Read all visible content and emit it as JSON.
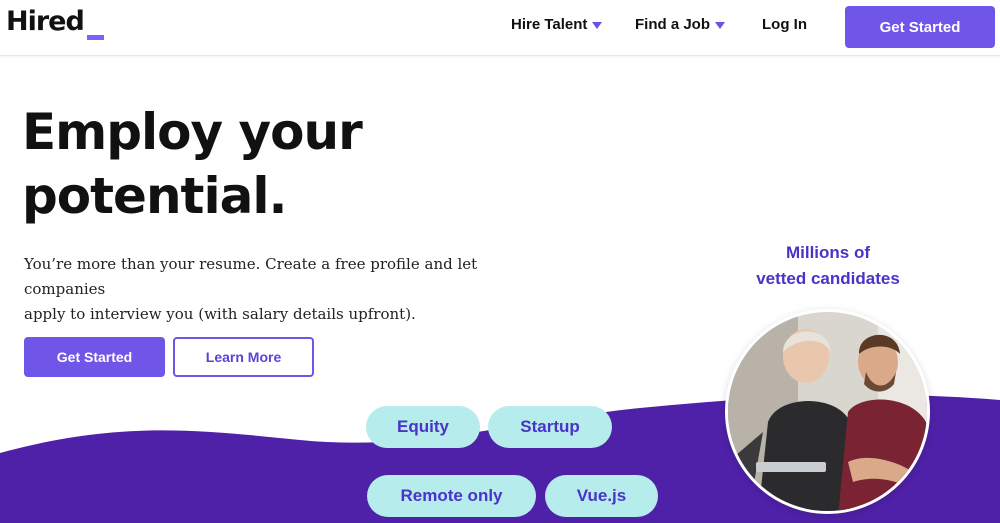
{
  "header": {
    "logo": "Hired",
    "nav": {
      "hire_talent": "Hire Talent",
      "find_job": "Find a Job",
      "login": "Log In"
    },
    "cta": "Get Started"
  },
  "hero": {
    "title_line1": "Employ your",
    "title_line2": "potential.",
    "subtitle_line1": "You’re more than your resume. Create a free profile and let companies",
    "subtitle_line2": "apply to interview you (with salary details upfront).",
    "primary_button": "Get Started",
    "secondary_button": "Learn More"
  },
  "tags": [
    "Equity",
    "Startup",
    "Remote only",
    "Vue.js"
  ],
  "promo": {
    "line1": "Millions of",
    "line2": "vetted candidates"
  },
  "colors": {
    "brand_purple": "#6f55e8",
    "wave_purple": "#4f21a8",
    "pill_bg": "#b6ecec",
    "pill_text": "#4a33c8"
  }
}
